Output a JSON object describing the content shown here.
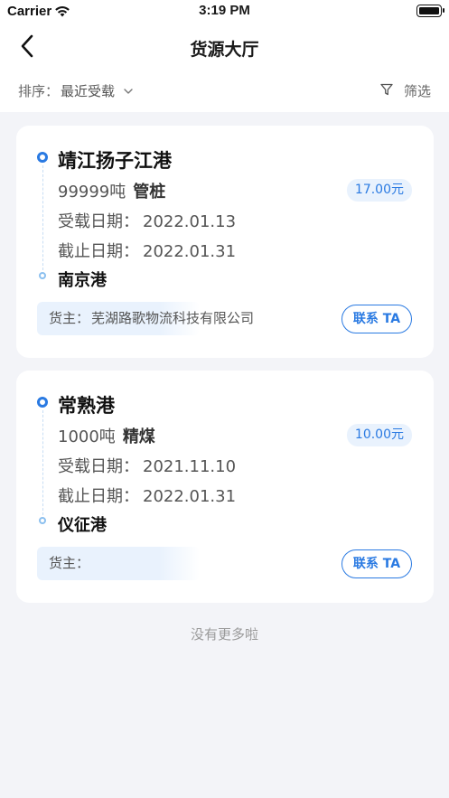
{
  "status_bar": {
    "carrier": "Carrier",
    "time": "3:19 PM"
  },
  "nav": {
    "title": "货源大厅"
  },
  "toolbar": {
    "sort_label": "排序：",
    "sort_value": "最近受载",
    "filter_label": "筛选"
  },
  "listings": [
    {
      "origin": "靖江扬子江港",
      "tonnage": "99999吨",
      "cargo": "管桩",
      "price": "17.00元",
      "load_date_label": "受载日期：",
      "load_date": "2022.01.13",
      "deadline_label": "截止日期：",
      "deadline": "2022.01.31",
      "destination": "南京港",
      "owner_label": "货主：",
      "owner": "芜湖路歌物流科技有限公司",
      "contact_label": "联系 TA"
    },
    {
      "origin": "常熟港",
      "tonnage": "1000吨",
      "cargo": "精煤",
      "price": "10.00元",
      "load_date_label": "受载日期：",
      "load_date": "2021.11.10",
      "deadline_label": "截止日期：",
      "deadline": "2022.01.31",
      "destination": "仪征港",
      "owner_label": "货主：",
      "owner": "",
      "contact_label": "联系 TA"
    }
  ],
  "footer": {
    "end_text": "没有更多啦"
  },
  "colors": {
    "accent": "#2a7ae2",
    "price_bg": "#e9f2fd",
    "page_bg": "#f3f4f8"
  },
  "icons": {
    "back": "chevron-left-icon",
    "sort": "chevron-down-icon",
    "filter": "funnel-icon",
    "wifi": "wifi-icon",
    "battery": "battery-icon"
  }
}
